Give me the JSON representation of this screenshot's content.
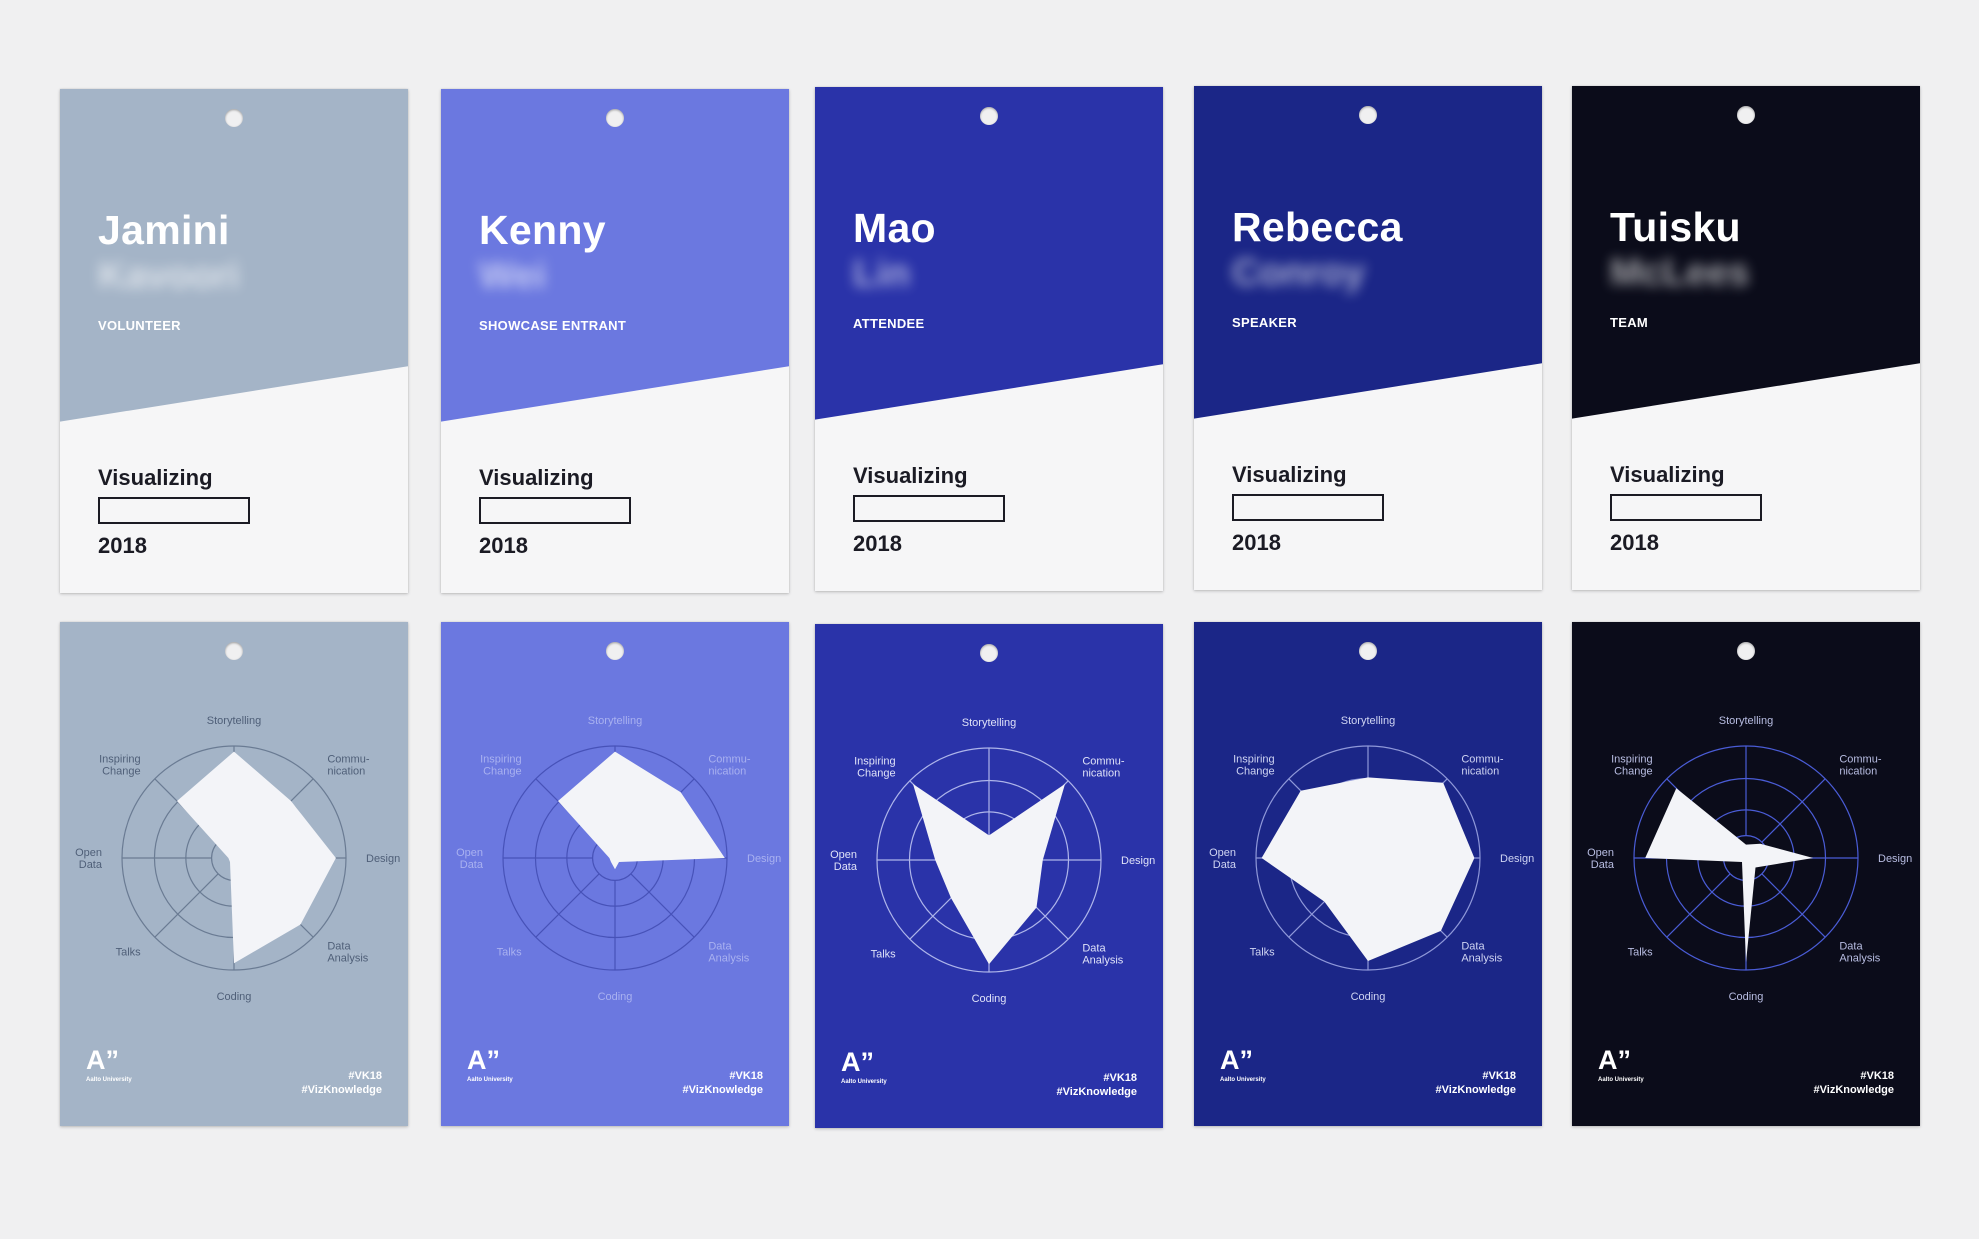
{
  "event": {
    "visualizing_label": "Visualizing",
    "year": "2018",
    "hashtag_1": "#VK18",
    "hashtag_2": "#VizKnowledge",
    "logo_mark": "A”",
    "logo_text": "Aalto University"
  },
  "chart_axes": [
    "Storytelling",
    "Commu-\nnication",
    "Design",
    "Data\nAnalysis",
    "Coding",
    "Talks",
    "Open\nData",
    "Inspiring\nChange"
  ],
  "badges": [
    {
      "first_name": "Jamini",
      "last_name": "Kavoori",
      "role": "VOLUNTEER",
      "color": "#a4b4c7",
      "label_color": "#4f5f78",
      "line_color": "#6a7b93",
      "skills": [
        0.95,
        0.72,
        0.91,
        0.84,
        0.94,
        0.05,
        0.05,
        0.72
      ]
    },
    {
      "first_name": "Kenny",
      "last_name": "Wei",
      "role": "SHOWCASE ENTRANT",
      "color": "#6b78e0",
      "label_color": "#a9b1f0",
      "line_color": "#4752b8",
      "skills": [
        0.95,
        0.83,
        0.98,
        0.05,
        0.1,
        0.05,
        0.05,
        0.72
      ]
    },
    {
      "first_name": "Mao",
      "last_name": "Lin",
      "role": "ATTENDEE",
      "color": "#2a33a9",
      "label_color": "#dfe2f8",
      "line_color": "#aeb5ea",
      "skills": [
        0.22,
        0.96,
        0.48,
        0.6,
        0.93,
        0.48,
        0.48,
        0.96
      ]
    },
    {
      "first_name": "Rebecca",
      "last_name": "Conroy",
      "role": "SPEAKER",
      "color": "#1b2687",
      "label_color": "#cfd4f2",
      "line_color": "#8f98d9",
      "skills": [
        0.72,
        0.95,
        0.95,
        0.92,
        0.92,
        0.55,
        0.95,
        0.85
      ]
    },
    {
      "first_name": "Tuisku",
      "last_name": "McLees",
      "role": "TEAM",
      "color": "#0b0c1a",
      "label_color": "#b8bde2",
      "line_color": "#4a5cd6",
      "skills": [
        0.12,
        0.18,
        0.6,
        0.12,
        0.93,
        0.05,
        0.9,
        0.88
      ]
    }
  ]
}
